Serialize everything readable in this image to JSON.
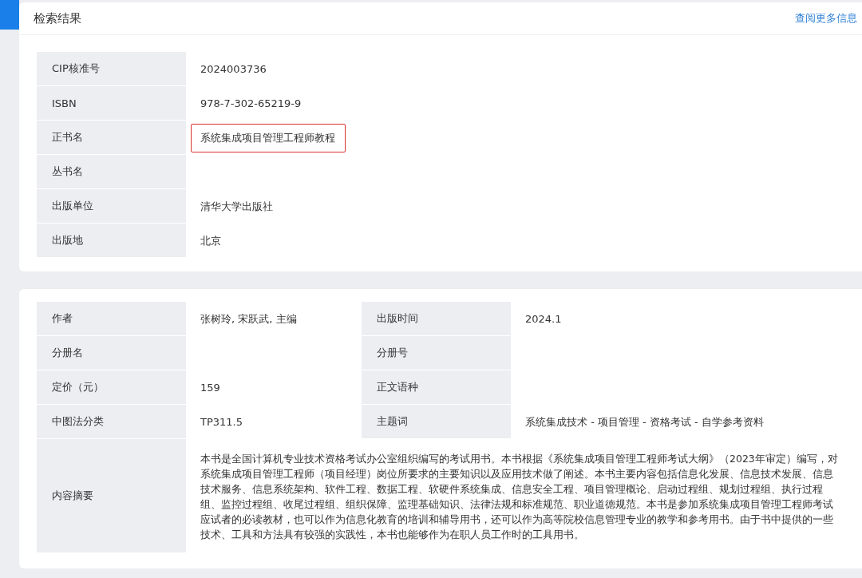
{
  "header": {
    "title": "检索结果",
    "link": "查阅更多信息"
  },
  "basic_fields": [
    {
      "label": "CIP核准号",
      "value": "2024003736",
      "highlighted": false
    },
    {
      "label": "ISBN",
      "value": "978-7-302-65219-9",
      "highlighted": false
    },
    {
      "label": "正书名",
      "value": "系统集成项目管理工程师教程",
      "highlighted": true
    },
    {
      "label": "丛书名"
    },
    {
      "label": "出版单位",
      "value": "清华大学出版社",
      "highlighted": false
    },
    {
      "label": "出版地",
      "value": "北京",
      "highlighted": false
    }
  ],
  "detail_rows": [
    [
      {
        "label": "作者",
        "value": "张树玲, 宋跃武, 主编"
      },
      {
        "label": "出版时间",
        "value": "2024.1"
      }
    ],
    [
      {
        "label": "分册名"
      },
      {
        "label": "分册号"
      }
    ],
    [
      {
        "label": "定价（元）",
        "value": "159"
      },
      {
        "label": "正文语种"
      }
    ],
    [
      {
        "label": "中图法分类",
        "value": "TP311.5"
      },
      {
        "label": "主题词",
        "value": "系统集成技术 - 项目管理 - 资格考试 - 自学参考资料"
      }
    ]
  ],
  "summary": {
    "label": "内容摘要",
    "text": "本书是全国计算机专业技术资格考试办公室组织编写的考试用书。本书根据《系统集成项目管理工程师考试大纲》（2023年审定）编写，对系统集成项目管理工程师（项目经理）岗位所要求的主要知识以及应用技术做了阐述。本书主要内容包括信息化发展、信息技术发展、信息技术服务、信息系统架构、软件工程、数据工程、软硬件系统集成、信息安全工程、项目管理概论、启动过程组、规划过程组、执行过程组、监控过程组、收尾过程组、组织保障、监理基础知识、法律法规和标准规范、职业道德规范。本书是参加系统集成项目管理工程师考试应试者的必读教材，也可以作为信息化教育的培训和辅导用书，还可以作为高等院校信息管理专业的教学和参考用书。由于书中提供的一些技术、工具和方法具有较强的实践性，本书也能够作为在职人员工作时的工具用书。"
  }
}
